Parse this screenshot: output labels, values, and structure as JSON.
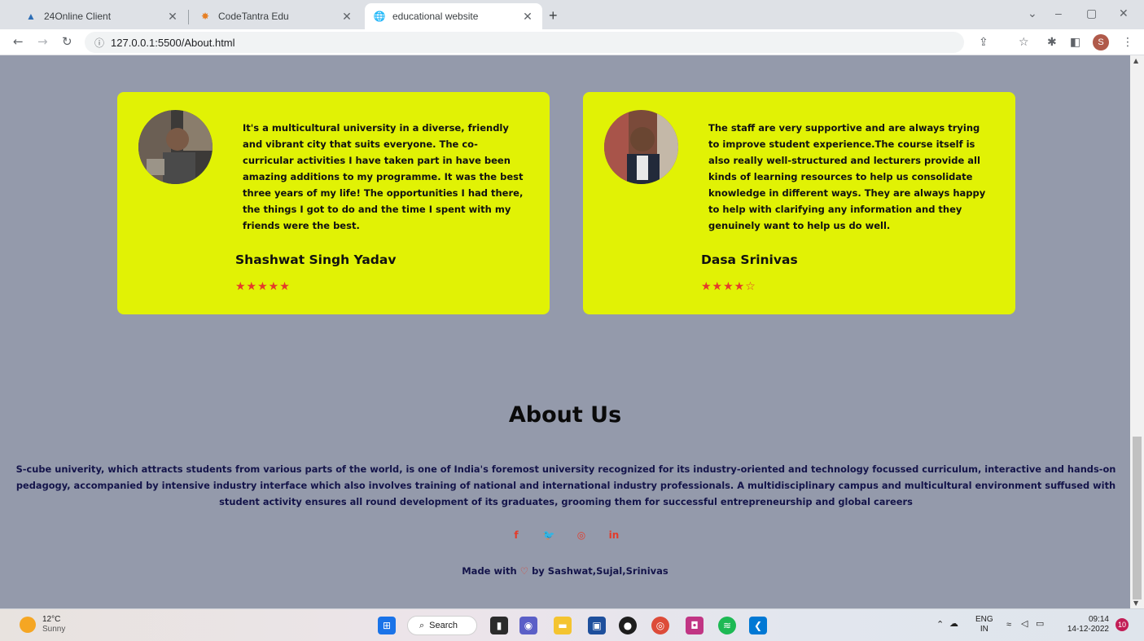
{
  "browser": {
    "tabs": [
      {
        "title": "24Online Client",
        "close": "✕"
      },
      {
        "title": "CodeTantra Edu",
        "close": "✕"
      },
      {
        "title": "educational website",
        "close": "✕"
      }
    ],
    "new_tab": "+",
    "url": "127.0.0.1:5500/About.html",
    "profile_initial": "S",
    "window_controls": {
      "dropdown": "⌄",
      "minimize": "–",
      "maximize": "▢",
      "close": "✕"
    }
  },
  "testimonials": [
    {
      "quote": "It's a multicultural university in a diverse, friendly and vibrant city that suits everyone. The co-curricular activities I have taken part in have been amazing additions to my programme. It was the best three years of my life! The opportunities I had there, the things I got to do and the time I spent with my friends were the best.",
      "name": "Shashwat Singh Yadav",
      "stars": "★★★★★",
      "rating": 5
    },
    {
      "quote": "The staff are very supportive and are always trying to improve student experience.The course itself is also really well-structured and lecturers provide all kinds of learning resources to help us consolidate knowledge in different ways. They are always happy to help with clarifying any information and they genuinely want to help us do well.",
      "name": "Dasa Srinivas",
      "stars": "★★★★☆",
      "rating": 4
    }
  ],
  "about": {
    "title": "About Us",
    "text": "S-cube univerity, which attracts students from various parts of the world, is one of India's foremost university recognized for its industry-oriented and technology focussed curriculum, interactive and hands-on pedagogy, accompanied by intensive industry interface which also involves training of national and international industry professionals. A multidisciplinary campus and multicultural environment suffused with student activity ensures all round development of its graduates, grooming them for successful entrepreneurship and global careers"
  },
  "social": {
    "facebook": "f",
    "twitter": "🐦",
    "instagram": "◎",
    "linkedin": "in"
  },
  "footer": {
    "made_with": "Made with",
    "heart": "♡",
    "by": "by Sashwat,Sujal,Srinivas"
  },
  "taskbar": {
    "temperature": "12°C",
    "weather": "Sunny",
    "search_label": "Search",
    "lang_top": "ENG",
    "lang_bottom": "IN",
    "time": "09:14",
    "date": "14-12-2022",
    "notifications": "10"
  }
}
